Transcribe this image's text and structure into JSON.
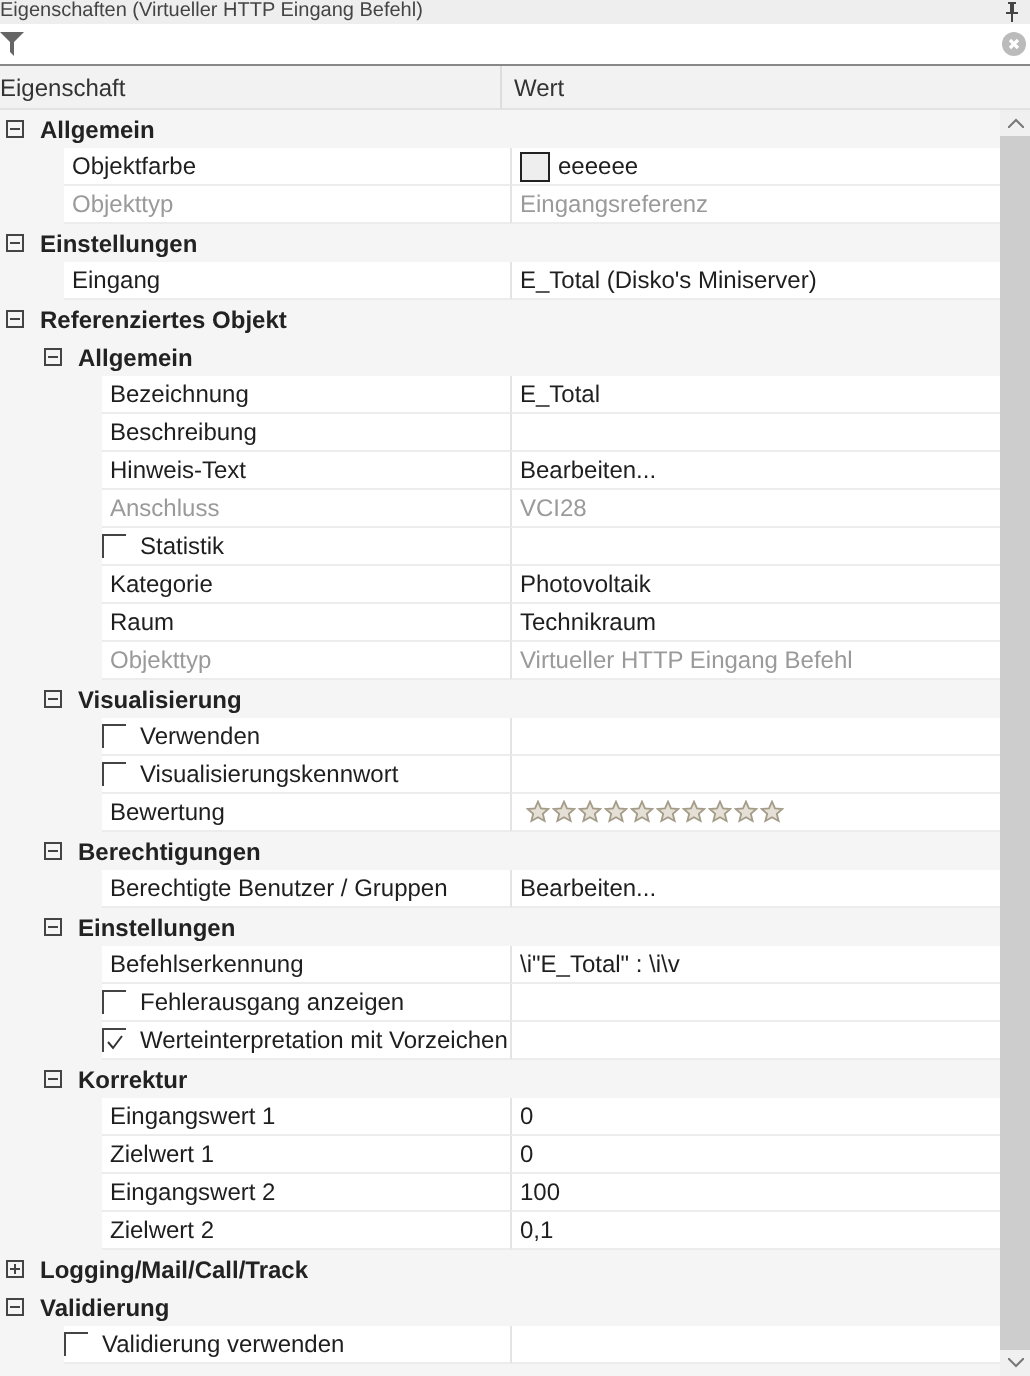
{
  "window": {
    "title": "Eigenschaften (Virtueller HTTP Eingang Befehl)"
  },
  "columns": [
    "Eigenschaft",
    "Wert"
  ],
  "tree": [
    {
      "kind": "group",
      "label": "Allgemein",
      "expanded": true,
      "children": [
        {
          "kind": "color",
          "label": "Objektfarbe",
          "value": "eeeeee",
          "disabled": false
        },
        {
          "kind": "text",
          "label": "Objekttyp",
          "value": "Eingangsreferenz",
          "disabled": true
        }
      ]
    },
    {
      "kind": "group",
      "label": "Einstellungen",
      "expanded": true,
      "children": [
        {
          "kind": "text",
          "label": "Eingang",
          "value": "E_Total (Disko's Miniserver)",
          "disabled": false
        }
      ]
    },
    {
      "kind": "group",
      "label": "Referenziertes Objekt",
      "expanded": true,
      "children": [
        {
          "kind": "group",
          "label": "Allgemein",
          "expanded": true,
          "children": [
            {
              "kind": "text",
              "label": "Bezeichnung",
              "value": "E_Total",
              "disabled": false
            },
            {
              "kind": "text",
              "label": "Beschreibung",
              "disabled": false
            },
            {
              "kind": "text",
              "label": "Hinweis-Text",
              "value": "Bearbeiten...",
              "disabled": false
            },
            {
              "kind": "text",
              "label": "Anschluss",
              "value": "VCI28",
              "disabled": true
            },
            {
              "kind": "checkbox",
              "label": "Statistik",
              "checked": false
            },
            {
              "kind": "text",
              "label": "Kategorie",
              "value": "Photovoltaik",
              "disabled": false
            },
            {
              "kind": "text",
              "label": "Raum",
              "value": "Technikraum",
              "disabled": false
            },
            {
              "kind": "text",
              "label": "Objekttyp",
              "value": "Virtueller HTTP Eingang Befehl",
              "disabled": true
            }
          ]
        },
        {
          "kind": "group",
          "label": "Visualisierung",
          "expanded": true,
          "children": [
            {
              "kind": "checkbox",
              "label": "Verwenden",
              "checked": false
            },
            {
              "kind": "checkbox",
              "label": "Visualisierungskennwort",
              "checked": false
            },
            {
              "kind": "stars",
              "label": "Bewertung",
              "stars": 0
            }
          ]
        },
        {
          "kind": "group",
          "label": "Berechtigungen",
          "expanded": true,
          "children": [
            {
              "kind": "text",
              "label": "Berechtigte Benutzer / Gruppen",
              "value": "Bearbeiten...",
              "disabled": false
            }
          ]
        },
        {
          "kind": "group",
          "label": "Einstellungen",
          "expanded": true,
          "children": [
            {
              "kind": "text",
              "label": "Befehlserkennung",
              "value": "\\i\"E_Total\" : \\i\\v",
              "disabled": false
            },
            {
              "kind": "checkbox",
              "label": "Fehlerausgang anzeigen",
              "checked": false
            },
            {
              "kind": "checkbox",
              "label": "Werteinterpretation mit Vorzeichen",
              "checked": true
            }
          ]
        },
        {
          "kind": "group",
          "label": "Korrektur",
          "expanded": true,
          "children": [
            {
              "kind": "text",
              "label": "Eingangswert 1",
              "value": "0",
              "disabled": false
            },
            {
              "kind": "text",
              "label": "Zielwert 1",
              "value": "0",
              "disabled": false
            },
            {
              "kind": "text",
              "label": "Eingangswert 2",
              "value": "100",
              "disabled": false
            },
            {
              "kind": "text",
              "label": "Zielwert 2",
              "value": "0,1",
              "disabled": false
            }
          ]
        }
      ]
    },
    {
      "kind": "group",
      "label": "Logging/Mail/Call/Track",
      "expanded": false
    },
    {
      "kind": "group",
      "label": "Validierung",
      "expanded": true,
      "children": [
        {
          "kind": "checkbox",
          "label": "Validierung verwenden",
          "checked": false
        }
      ]
    }
  ]
}
